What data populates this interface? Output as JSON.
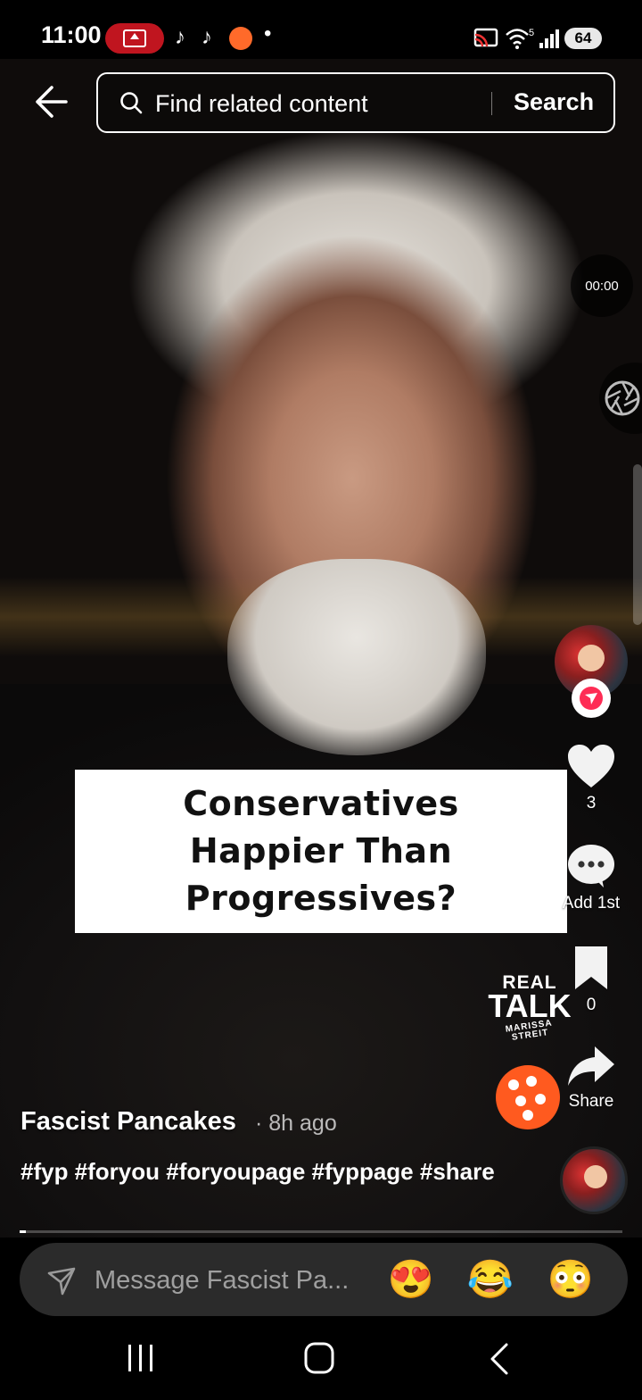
{
  "status_bar": {
    "time": "11:00",
    "battery": "64",
    "icons": [
      "screen-record-icon",
      "tiktok-icon",
      "tiktok-icon",
      "record-icon",
      "dot-icon",
      "cast-icon",
      "wifi-5-icon",
      "signal-icon",
      "battery-icon"
    ]
  },
  "search": {
    "placeholder": "Find related content",
    "button": "Search"
  },
  "video": {
    "timer": "00:00",
    "caption_lines": [
      "Conservatives",
      "Happier Than",
      "Progressives?"
    ],
    "progress": 0.01,
    "brand": {
      "line1": "REAL",
      "line2": "TALK",
      "line3": "MARISSA STREIT"
    }
  },
  "rail": {
    "likes": "3",
    "comments": "Add 1st",
    "saves": "0",
    "share": "Share"
  },
  "post": {
    "author": "Fascist Pancakes",
    "time_ago": "· 8h ago",
    "hashtags": "#fyp #foryou #foryoupage #fyppage #share"
  },
  "message": {
    "placeholder": "Message Fascist Pa...",
    "emojis": [
      "😍",
      "😂",
      "😳"
    ]
  },
  "colors": {
    "accent": "#fe2c55",
    "fab": "#ff5a1f",
    "record_pill": "#c0151f"
  }
}
